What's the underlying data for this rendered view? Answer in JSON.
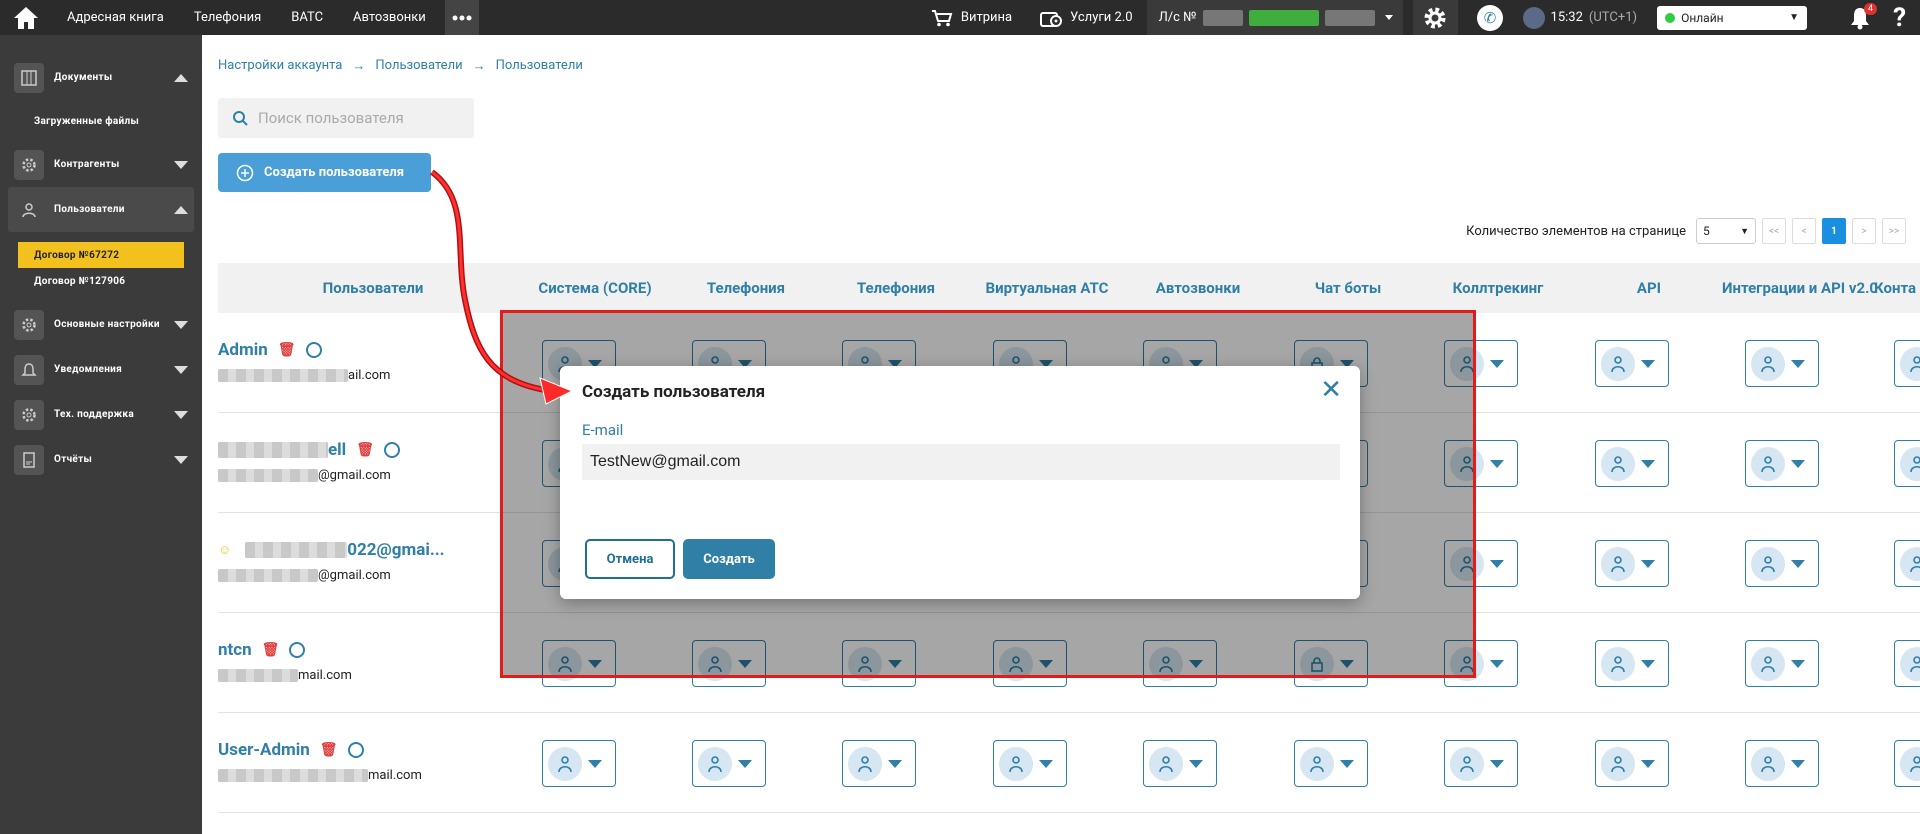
{
  "topbar": {
    "nav": [
      "Адресная книга",
      "Телефония",
      "ВАТС",
      "Автозвонки"
    ],
    "showcase": "Витрина",
    "services": "Услуги 2.0",
    "account_prefix": "Л/с №",
    "time": "15:32",
    "timezone": "(UTC+1)",
    "status": "Онлайн",
    "notifications": "4",
    "help": "?"
  },
  "sidebar": {
    "items": [
      {
        "label": "Документы",
        "icon": "docs-icon",
        "expanded": true
      },
      {
        "label": "Контрагенты",
        "icon": "gear-icon",
        "expanded": false
      },
      {
        "label": "Пользователи",
        "icon": "user-icon",
        "expanded": true
      },
      {
        "label": "Основные настройки",
        "icon": "gear-icon",
        "expanded": false
      },
      {
        "label": "Уведомления",
        "icon": "bell-icon",
        "expanded": false
      },
      {
        "label": "Тех. поддержка",
        "icon": "gear-icon",
        "expanded": false
      },
      {
        "label": "Отчёты",
        "icon": "report-icon",
        "expanded": false
      }
    ],
    "sub_docs": "Загруженные файлы",
    "sub_users": [
      "Договор №67272",
      "Договор №127906"
    ]
  },
  "breadcrumbs": [
    "Настройки аккаунта",
    "Пользователи",
    "Пользователи"
  ],
  "search_placeholder": "Поиск пользователя",
  "create_button": "Создать пользователя",
  "pager": {
    "label": "Количество элементов на странице",
    "size": "5",
    "first": "<<",
    "prev": "<",
    "page": "1",
    "next": ">",
    "last": ">>"
  },
  "columns": [
    "Пользователи",
    "Система (CORE)",
    "Телефония",
    "Телефония",
    "Виртуальная АТС",
    "Автозвонки",
    "Чат боты",
    "Коллтрекинг",
    "API",
    "Интеграции и API v2.0",
    "Конта"
  ],
  "users": [
    {
      "name": "Admin",
      "email_suffix": "ail.com"
    },
    {
      "name": "ell",
      "email_suffix": "@gmail.com"
    },
    {
      "name": "022@gmai...",
      "email_suffix": "@gmail.com"
    },
    {
      "name": "ntcn",
      "email_suffix": "mail.com"
    },
    {
      "name": "User-Admin",
      "email_suffix": "mail.com"
    }
  ],
  "modal": {
    "title": "Создать пользователя",
    "email_label": "E-mail",
    "email_value": "TestNew@gmail.com",
    "cancel": "Отмена",
    "submit": "Создать"
  },
  "colors": {
    "accent": "#2f7fa6",
    "highlight": "#f3c11d",
    "annotation": "#e21b1b"
  }
}
